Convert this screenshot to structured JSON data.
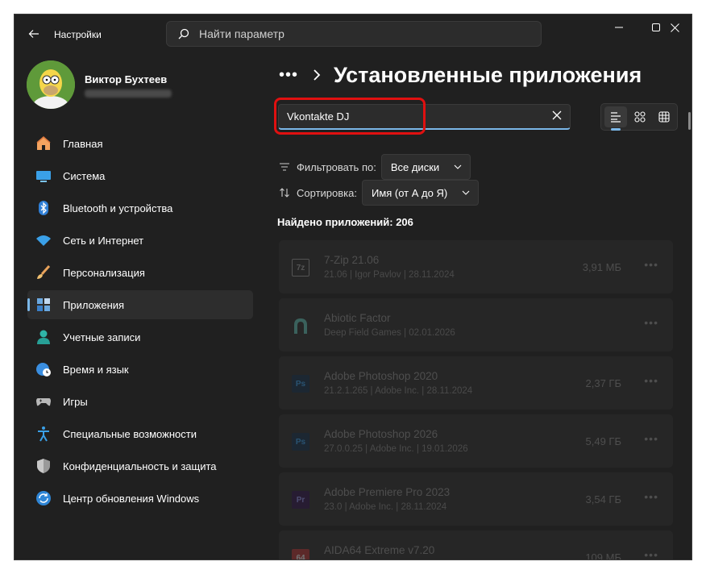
{
  "titlebar": {
    "app_title": "Настройки",
    "search_placeholder": "Найти параметр"
  },
  "profile": {
    "name": "Виктор Бухтеев"
  },
  "sidebar": {
    "items": [
      {
        "label": "Главная",
        "icon": "home-icon",
        "active": false
      },
      {
        "label": "Система",
        "icon": "system-icon",
        "active": false
      },
      {
        "label": "Bluetooth и устройства",
        "icon": "bluetooth-icon",
        "active": false
      },
      {
        "label": "Сеть и Интернет",
        "icon": "wifi-icon",
        "active": false
      },
      {
        "label": "Персонализация",
        "icon": "brush-icon",
        "active": false
      },
      {
        "label": "Приложения",
        "icon": "apps-icon",
        "active": true
      },
      {
        "label": "Учетные записи",
        "icon": "account-icon",
        "active": false
      },
      {
        "label": "Время и язык",
        "icon": "globe-clock-icon",
        "active": false
      },
      {
        "label": "Игры",
        "icon": "gamepad-icon",
        "active": false
      },
      {
        "label": "Специальные возможности",
        "icon": "accessibility-icon",
        "active": false
      },
      {
        "label": "Конфиденциальность и защита",
        "icon": "shield-icon",
        "active": false
      },
      {
        "label": "Центр обновления Windows",
        "icon": "update-icon",
        "active": false
      }
    ]
  },
  "main": {
    "breadcrumb_more": "•••",
    "page_title": "Установленные приложения",
    "app_search_value": "Vkontakte DJ",
    "filter_label": "Фильтровать по:",
    "filter_value": "Все диски",
    "sort_label": "Сортировка:",
    "sort_value": "Имя (от А до Я)",
    "found_text": "Найдено приложений: 206",
    "apps": [
      {
        "name": "7-Zip 21.06",
        "meta": "21.06  |  Igor Pavlov  |  28.11.2024",
        "size": "3,91 МБ",
        "logo": "7z"
      },
      {
        "name": "Abiotic Factor",
        "meta": "Deep Field Games  |  02.01.2026",
        "size": "",
        "logo": "af"
      },
      {
        "name": "Adobe Photoshop 2020",
        "meta": "21.2.1.265  |  Adobe Inc.  |  28.11.2024",
        "size": "2,37 ГБ",
        "logo": "Ps"
      },
      {
        "name": "Adobe Photoshop 2026",
        "meta": "27.0.0.25  |  Adobe Inc.  |  19.01.2026",
        "size": "5,49 ГБ",
        "logo": "Ps"
      },
      {
        "name": "Adobe Premiere Pro 2023",
        "meta": "23.0  |  Adobe Inc.  |  28.11.2024",
        "size": "3,54 ГБ",
        "logo": "Pr"
      },
      {
        "name": "AIDA64 Extreme v7.20",
        "meta": "",
        "size": "109 МБ",
        "logo": "64"
      }
    ]
  },
  "colors": {
    "accent": "#7bb7e8",
    "highlight": "#e01010",
    "background": "#202020"
  }
}
